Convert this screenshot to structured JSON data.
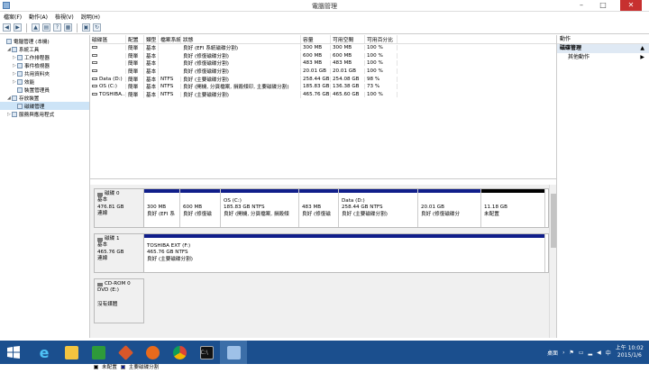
{
  "window": {
    "title": "電腦管理"
  },
  "menu": [
    "檔案(F)",
    "動作(A)",
    "檢視(V)",
    "說明(H)"
  ],
  "toolbar_icons": [
    "back-icon",
    "forward-icon",
    "up-folder-icon",
    "properties-icon",
    "help-icon",
    "view-icon",
    "console-icon",
    "refresh-icon"
  ],
  "tree": [
    {
      "label": "電腦管理 (本機)",
      "level": 0,
      "toggle": "",
      "icon": "computer-management-icon"
    },
    {
      "label": "系統工具",
      "level": 1,
      "toggle": "◢",
      "icon": "system-tools-icon"
    },
    {
      "label": "工作排程器",
      "level": 2,
      "toggle": "▷",
      "icon": "task-scheduler-icon"
    },
    {
      "label": "事件檢視器",
      "level": 2,
      "toggle": "▷",
      "icon": "event-viewer-icon"
    },
    {
      "label": "共用資料夾",
      "level": 2,
      "toggle": "▷",
      "icon": "shared-folders-icon"
    },
    {
      "label": "效能",
      "level": 2,
      "toggle": "▷",
      "icon": "performance-icon"
    },
    {
      "label": "裝置管理員",
      "level": 2,
      "toggle": "",
      "icon": "device-manager-icon"
    },
    {
      "label": "存放裝置",
      "level": 1,
      "toggle": "◢",
      "icon": "storage-icon"
    },
    {
      "label": "磁碟管理",
      "level": 2,
      "toggle": "",
      "icon": "disk-management-icon",
      "selected": true
    },
    {
      "label": "服務與應用程式",
      "level": 1,
      "toggle": "▷",
      "icon": "services-icon"
    }
  ],
  "volumes": {
    "headers": [
      "磁碟區",
      "配置",
      "類型",
      "檔案系統",
      "狀態",
      "容量",
      "可用空間",
      "可用百分比"
    ],
    "rows": [
      [
        "",
        "簡單",
        "基本",
        "",
        "良好 (EFI 系統磁碟分割)",
        "300 MB",
        "300 MB",
        "100 %"
      ],
      [
        "",
        "簡單",
        "基本",
        "",
        "良好 (修復磁碟分割)",
        "600 MB",
        "600 MB",
        "100 %"
      ],
      [
        "",
        "簡單",
        "基本",
        "",
        "良好 (修復磁碟分割)",
        "483 MB",
        "483 MB",
        "100 %"
      ],
      [
        "",
        "簡單",
        "基本",
        "",
        "良好 (修復磁碟分割)",
        "20.01 GB",
        "20.01 GB",
        "100 %"
      ],
      [
        "Data (D:)",
        "簡單",
        "基本",
        "NTFS",
        "良好 (主要磁碟分割)",
        "258.44 GB",
        "254.08 GB",
        "98 %"
      ],
      [
        "OS (C:)",
        "簡單",
        "基本",
        "NTFS",
        "良好 (開機, 分頁檔案, 損毀傾印, 主要磁碟分割)",
        "185.83 GB",
        "136.38 GB",
        "73 %"
      ],
      [
        "TOSHIBA...",
        "簡單",
        "基本",
        "NTFS",
        "良好 (主要磁碟分割)",
        "465.76 GB",
        "465.60 GB",
        "100 %"
      ]
    ]
  },
  "disks": [
    {
      "name": "磁碟 0",
      "type": "基本",
      "size": "476.81 GB",
      "status": "連線",
      "parts": [
        {
          "lines": [
            "",
            "300 MB",
            "良好 (EFI 系"
          ],
          "w": 40
        },
        {
          "lines": [
            "",
            "600 MB",
            "良好 (修復磁"
          ],
          "w": 45
        },
        {
          "lines": [
            "OS (C:)",
            "185.83 GB NTFS",
            "良好 (開機, 分頁檔案, 損毀傾"
          ],
          "w": 87
        },
        {
          "lines": [
            "",
            "483 MB",
            "良好 (修復磁"
          ],
          "w": 44
        },
        {
          "lines": [
            "Data (D:)",
            "258.44 GB NTFS",
            "良好 (主要磁碟分割)"
          ],
          "w": 88
        },
        {
          "lines": [
            "",
            "20.01 GB",
            "良好 (修復磁碟分"
          ],
          "w": 70
        },
        {
          "lines": [
            "",
            "11.18 GB",
            "未配置"
          ],
          "w": 71,
          "unallocated": true
        }
      ]
    },
    {
      "name": "磁碟 1",
      "type": "基本",
      "size": "465.76 GB",
      "status": "連線",
      "parts": [
        {
          "lines": [
            "TOSHIBA EXT  (F:)",
            "465.76 GB NTFS",
            "良好 (主要磁碟分割)"
          ],
          "w": 445
        }
      ]
    },
    {
      "name": "CD-ROM 0",
      "type": "DVD (E:)",
      "size": "",
      "status": "沒有媒體",
      "parts": []
    }
  ],
  "legend": [
    {
      "label": "未配置",
      "color": "#000000"
    },
    {
      "label": "主要磁碟分割",
      "color": "#101e8a"
    }
  ],
  "actions": {
    "header": "動作",
    "group": "磁碟管理",
    "item": "其他動作"
  },
  "taskbar": {
    "apps": [
      "windows-start-icon",
      "internet-explorer-icon",
      "file-explorer-icon",
      "store-icon",
      "media-icon",
      "firefox-icon",
      "chrome-icon",
      "command-prompt-icon",
      "computer-management-icon"
    ],
    "desktop": "桌面",
    "time": "上午 10:02",
    "date": "2015/1/6"
  },
  "colors": {
    "primary_partition": "#101e8a",
    "unallocated": "#000000",
    "taskbar": "#1b4f8e"
  }
}
